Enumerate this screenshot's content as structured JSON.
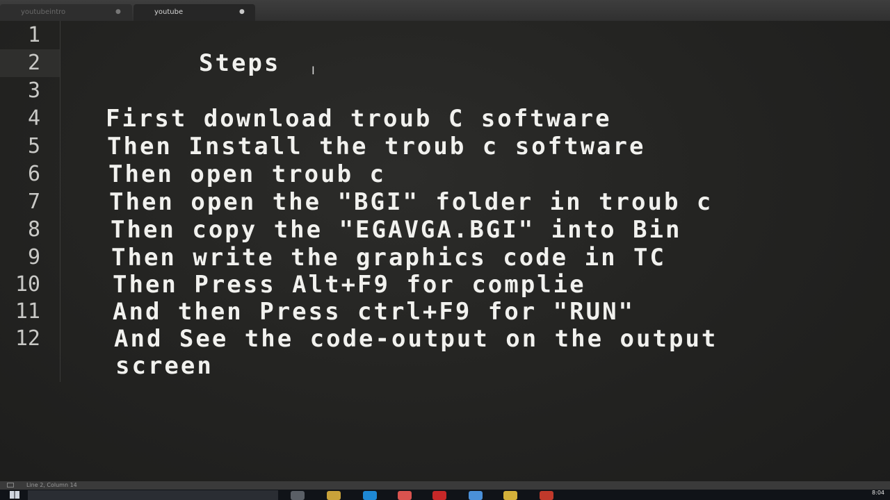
{
  "tabs": [
    {
      "label": "youtubeintro",
      "close": "●"
    },
    {
      "label": "youtube",
      "close": "●"
    }
  ],
  "editor": {
    "lines": [
      {
        "number": "1",
        "text": ""
      },
      {
        "number": "2",
        "text": "Steps"
      },
      {
        "number": "3",
        "text": ""
      },
      {
        "number": "4",
        "text": "First download troub C software"
      },
      {
        "number": "5",
        "text": "Then Install the troub c software"
      },
      {
        "number": "6",
        "text": "Then open troub c"
      },
      {
        "number": "7",
        "text": "Then open the \"BGI\" folder in troub c"
      },
      {
        "number": "8",
        "text": "Then copy the \"EGAVGA.BGI\" into Bin"
      },
      {
        "number": "9",
        "text": "Then write the graphics code in TC"
      },
      {
        "number": "10",
        "text": "Then Press Alt+F9 for complie"
      },
      {
        "number": "11",
        "text": "And then Press ctrl+F9 for \"RUN\""
      },
      {
        "number": "12",
        "text": "And See the code-output on the output"
      },
      {
        "number": "",
        "text": "screen"
      }
    ],
    "cursor_glyph": "I"
  },
  "statusbar": {
    "position": "Line 2, Column 14"
  },
  "taskbar": {
    "clock": "8:04",
    "icon_colors": [
      "#5a5f66",
      "#c9a23a",
      "#1e88d4",
      "#d9534f",
      "#c62828",
      "#4a90d9",
      "#d4b13a",
      "#c0392b"
    ]
  }
}
